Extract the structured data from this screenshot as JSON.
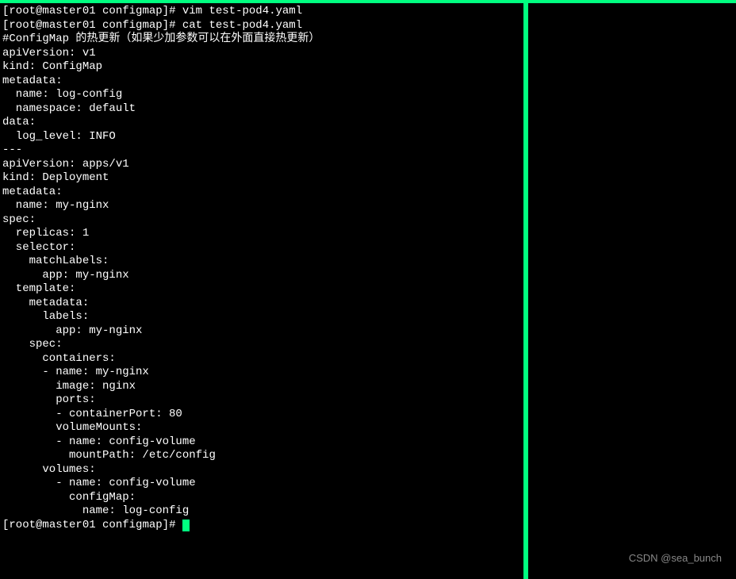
{
  "prompt": {
    "open_bracket": "[",
    "user": "root@master01",
    "path": "configmap",
    "close_bracket": "]",
    "hash": "#"
  },
  "commands": {
    "cmd1": "vim test-pod4.yaml",
    "cmd2": "cat test-pod4.yaml"
  },
  "output": {
    "l01": "#ConfigMap 的热更新（如果少加参数可以在外面直接热更新）",
    "l02": "apiVersion: v1",
    "l03": "kind: ConfigMap",
    "l04": "metadata:",
    "l05": "  name: log-config",
    "l06": "  namespace: default",
    "l07": "data:",
    "l08": "  log_level: INFO",
    "l09": "---",
    "l10": "apiVersion: apps/v1",
    "l11": "kind: Deployment",
    "l12": "metadata:",
    "l13": "  name: my-nginx",
    "l14": "spec:",
    "l15": "  replicas: 1",
    "l16": "  selector:",
    "l17": "    matchLabels:",
    "l18": "      app: my-nginx",
    "l19": "  template:",
    "l20": "    metadata:",
    "l21": "      labels:",
    "l22": "        app: my-nginx",
    "l23": "    spec:",
    "l24": "      containers:",
    "l25": "      - name: my-nginx",
    "l26": "        image: nginx",
    "l27": "        ports:",
    "l28": "        - containerPort: 80",
    "l29": "        volumeMounts:",
    "l30": "        - name: config-volume",
    "l31": "          mountPath: /etc/config",
    "l32": "      volumes:",
    "l33": "        - name: config-volume",
    "l34": "          configMap:",
    "l35": "            name: log-config"
  },
  "watermark": "CSDN @sea_bunch"
}
